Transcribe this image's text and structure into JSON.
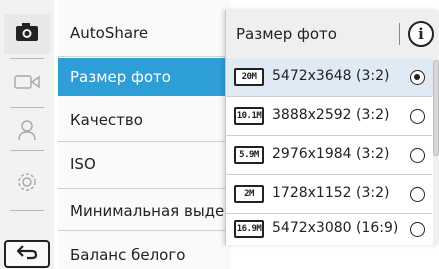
{
  "rail": {
    "icons": [
      "camera-icon",
      "video-icon",
      "person-icon",
      "settings-icon"
    ],
    "back_icon": "back-arrow-icon"
  },
  "menu": {
    "items": [
      {
        "label": "AutoShare"
      },
      {
        "label": "Размер фото",
        "active": true
      },
      {
        "label": "Качество"
      },
      {
        "label": "ISO"
      },
      {
        "label": "Минимальная выдер"
      },
      {
        "label": "Баланс белого"
      }
    ]
  },
  "popup": {
    "title": "Размер фото",
    "info_label": "i",
    "options": [
      {
        "icon_text": "20M",
        "label": "5472x3648 (3:2)",
        "selected": true
      },
      {
        "icon_text": "10.1M",
        "label": "3888x2592 (3:2)",
        "selected": false
      },
      {
        "icon_text": "5.9M",
        "label": "2976x1984 (3:2)",
        "selected": false
      },
      {
        "icon_text": "2M",
        "label": "1728x1152 (3:2)",
        "selected": false
      },
      {
        "icon_text": "16.9M",
        "label": "5472x3080 (16:9)",
        "selected": false
      }
    ]
  },
  "colors": {
    "accent": "#2e9fd6",
    "selected_row": "#dfeaf4"
  }
}
